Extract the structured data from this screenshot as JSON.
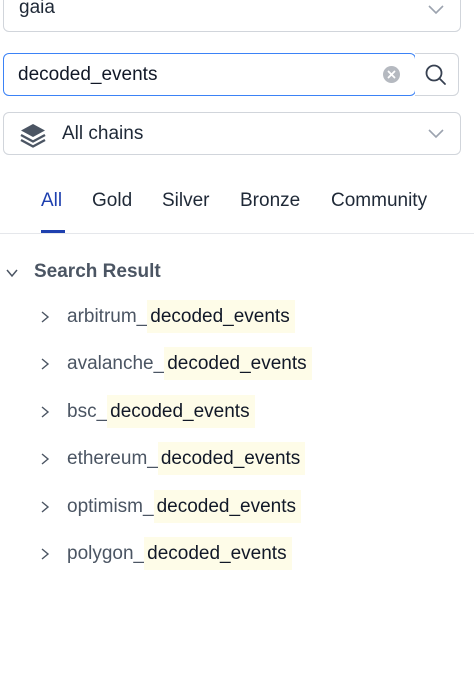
{
  "database_select": {
    "value": "gaia",
    "icon": "chevron-down-icon"
  },
  "search": {
    "value": "decoded_events",
    "clear_icon": "clear-icon",
    "search_icon": "search-icon"
  },
  "chain_select": {
    "value": "All chains",
    "icon": "layers-icon",
    "chevron": "chevron-down-icon"
  },
  "tabs": [
    {
      "label": "All",
      "active": true
    },
    {
      "label": "Gold",
      "active": false
    },
    {
      "label": "Silver",
      "active": false
    },
    {
      "label": "Bronze",
      "active": false
    },
    {
      "label": "Community",
      "active": false
    }
  ],
  "results": {
    "title": "Search Result",
    "items": [
      {
        "prefix": "arbitrum_",
        "match": "decoded_events"
      },
      {
        "prefix": "avalanche_",
        "match": "decoded_events"
      },
      {
        "prefix": "bsc_",
        "match": "decoded_events"
      },
      {
        "prefix": "ethereum_",
        "match": "decoded_events"
      },
      {
        "prefix": "optimism_",
        "match": "decoded_events"
      },
      {
        "prefix": "polygon_",
        "match": "decoded_events"
      }
    ]
  },
  "colors": {
    "accent": "#1e40af",
    "focus_border": "#3b82f6",
    "highlight": "#fefce8"
  }
}
